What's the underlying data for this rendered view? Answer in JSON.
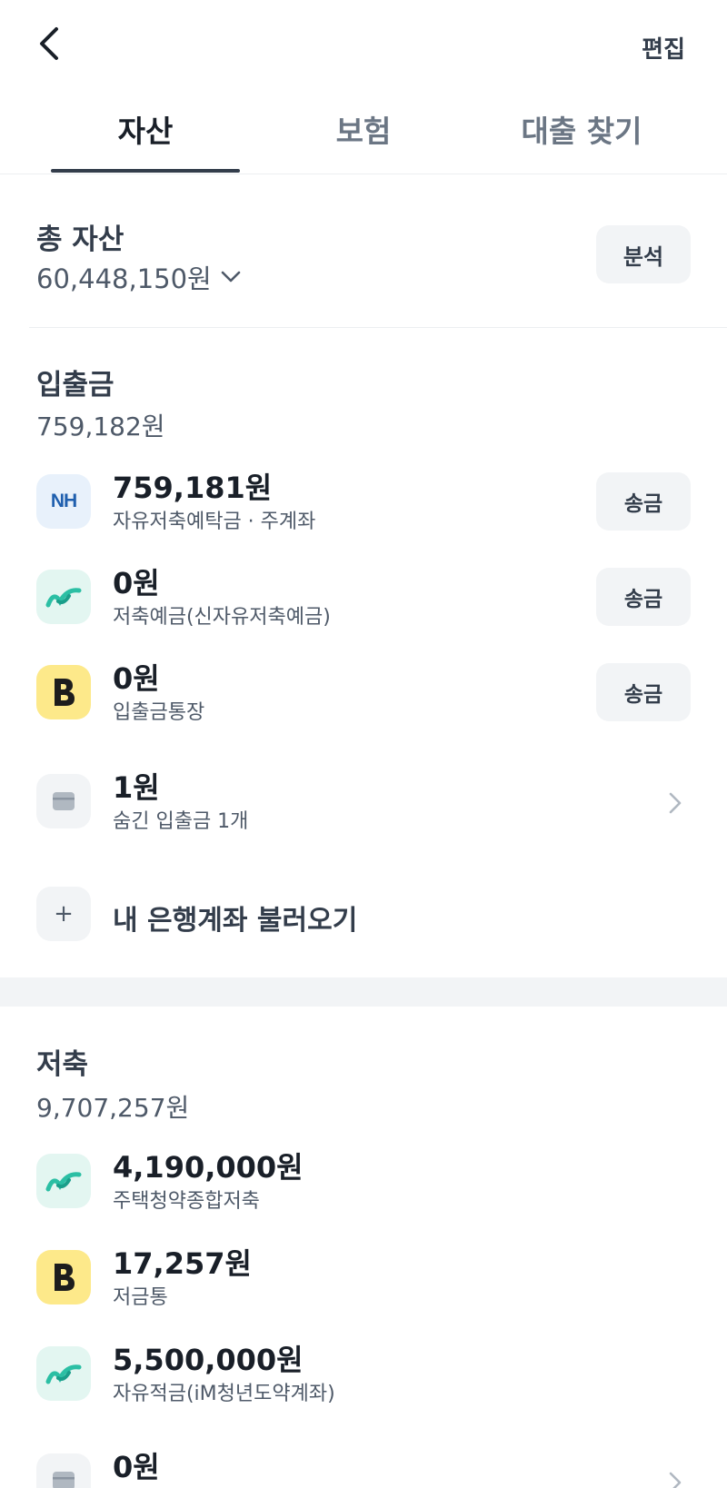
{
  "header": {
    "edit_label": "편집"
  },
  "tabs": [
    {
      "label": "자산",
      "active": true
    },
    {
      "label": "보험",
      "active": false
    },
    {
      "label": "대출 찾기",
      "active": false
    }
  ],
  "total": {
    "label": "총 자산",
    "value": "60,448,150원",
    "analyze_label": "분석"
  },
  "deposit": {
    "title": "입출금",
    "sum": "759,182원",
    "accounts": [
      {
        "logo": "NH",
        "amount": "759,181원",
        "name": "자유저축예탁금 · 주계좌",
        "send_label": "송금"
      },
      {
        "logo": "im-bank-icon",
        "amount": "0원",
        "name": "저축예금(신자유저축예금)",
        "send_label": "송금"
      },
      {
        "logo": "B",
        "amount": "0원",
        "name": "입출금통장",
        "send_label": "송금"
      },
      {
        "logo": "wallet-icon",
        "amount": "1원",
        "name": "숨긴 입출금 1개"
      }
    ],
    "add_label": "내 은행계좌 불러오기",
    "add_icon": "+"
  },
  "savings": {
    "title": "저축",
    "sum": "9,707,257원",
    "accounts": [
      {
        "logo": "im-bank-icon",
        "amount": "4,190,000원",
        "name": "주택청약종합저축"
      },
      {
        "logo": "B",
        "amount": "17,257원",
        "name": "저금통"
      },
      {
        "logo": "im-bank-icon",
        "amount": "5,500,000원",
        "name": "자유적금(iM청년도약계좌)"
      },
      {
        "logo": "wallet-icon",
        "amount": "0원",
        "name": ""
      }
    ]
  },
  "colors": {
    "text": "#191f28",
    "subtext": "#4e5968",
    "button_bg": "#f2f4f6",
    "nh_blue": "#1f5fae",
    "im_green": "#2bbfa4",
    "kakao_yellow": "#fde98a"
  }
}
